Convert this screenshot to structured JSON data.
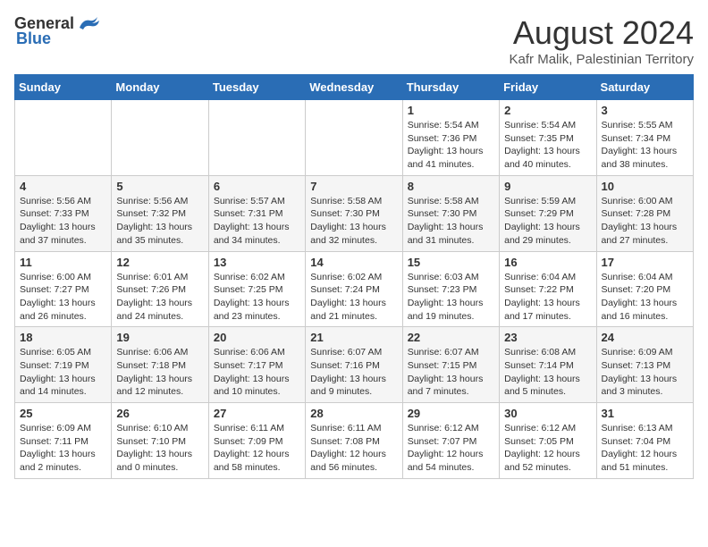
{
  "header": {
    "logo_general": "General",
    "logo_blue": "Blue",
    "title": "August 2024",
    "subtitle": "Kafr Malik, Palestinian Territory"
  },
  "calendar": {
    "days_of_week": [
      "Sunday",
      "Monday",
      "Tuesday",
      "Wednesday",
      "Thursday",
      "Friday",
      "Saturday"
    ],
    "weeks": [
      [
        {
          "day": "",
          "info": ""
        },
        {
          "day": "",
          "info": ""
        },
        {
          "day": "",
          "info": ""
        },
        {
          "day": "",
          "info": ""
        },
        {
          "day": "1",
          "info": "Sunrise: 5:54 AM\nSunset: 7:36 PM\nDaylight: 13 hours\nand 41 minutes."
        },
        {
          "day": "2",
          "info": "Sunrise: 5:54 AM\nSunset: 7:35 PM\nDaylight: 13 hours\nand 40 minutes."
        },
        {
          "day": "3",
          "info": "Sunrise: 5:55 AM\nSunset: 7:34 PM\nDaylight: 13 hours\nand 38 minutes."
        }
      ],
      [
        {
          "day": "4",
          "info": "Sunrise: 5:56 AM\nSunset: 7:33 PM\nDaylight: 13 hours\nand 37 minutes."
        },
        {
          "day": "5",
          "info": "Sunrise: 5:56 AM\nSunset: 7:32 PM\nDaylight: 13 hours\nand 35 minutes."
        },
        {
          "day": "6",
          "info": "Sunrise: 5:57 AM\nSunset: 7:31 PM\nDaylight: 13 hours\nand 34 minutes."
        },
        {
          "day": "7",
          "info": "Sunrise: 5:58 AM\nSunset: 7:30 PM\nDaylight: 13 hours\nand 32 minutes."
        },
        {
          "day": "8",
          "info": "Sunrise: 5:58 AM\nSunset: 7:30 PM\nDaylight: 13 hours\nand 31 minutes."
        },
        {
          "day": "9",
          "info": "Sunrise: 5:59 AM\nSunset: 7:29 PM\nDaylight: 13 hours\nand 29 minutes."
        },
        {
          "day": "10",
          "info": "Sunrise: 6:00 AM\nSunset: 7:28 PM\nDaylight: 13 hours\nand 27 minutes."
        }
      ],
      [
        {
          "day": "11",
          "info": "Sunrise: 6:00 AM\nSunset: 7:27 PM\nDaylight: 13 hours\nand 26 minutes."
        },
        {
          "day": "12",
          "info": "Sunrise: 6:01 AM\nSunset: 7:26 PM\nDaylight: 13 hours\nand 24 minutes."
        },
        {
          "day": "13",
          "info": "Sunrise: 6:02 AM\nSunset: 7:25 PM\nDaylight: 13 hours\nand 23 minutes."
        },
        {
          "day": "14",
          "info": "Sunrise: 6:02 AM\nSunset: 7:24 PM\nDaylight: 13 hours\nand 21 minutes."
        },
        {
          "day": "15",
          "info": "Sunrise: 6:03 AM\nSunset: 7:23 PM\nDaylight: 13 hours\nand 19 minutes."
        },
        {
          "day": "16",
          "info": "Sunrise: 6:04 AM\nSunset: 7:22 PM\nDaylight: 13 hours\nand 17 minutes."
        },
        {
          "day": "17",
          "info": "Sunrise: 6:04 AM\nSunset: 7:20 PM\nDaylight: 13 hours\nand 16 minutes."
        }
      ],
      [
        {
          "day": "18",
          "info": "Sunrise: 6:05 AM\nSunset: 7:19 PM\nDaylight: 13 hours\nand 14 minutes."
        },
        {
          "day": "19",
          "info": "Sunrise: 6:06 AM\nSunset: 7:18 PM\nDaylight: 13 hours\nand 12 minutes."
        },
        {
          "day": "20",
          "info": "Sunrise: 6:06 AM\nSunset: 7:17 PM\nDaylight: 13 hours\nand 10 minutes."
        },
        {
          "day": "21",
          "info": "Sunrise: 6:07 AM\nSunset: 7:16 PM\nDaylight: 13 hours\nand 9 minutes."
        },
        {
          "day": "22",
          "info": "Sunrise: 6:07 AM\nSunset: 7:15 PM\nDaylight: 13 hours\nand 7 minutes."
        },
        {
          "day": "23",
          "info": "Sunrise: 6:08 AM\nSunset: 7:14 PM\nDaylight: 13 hours\nand 5 minutes."
        },
        {
          "day": "24",
          "info": "Sunrise: 6:09 AM\nSunset: 7:13 PM\nDaylight: 13 hours\nand 3 minutes."
        }
      ],
      [
        {
          "day": "25",
          "info": "Sunrise: 6:09 AM\nSunset: 7:11 PM\nDaylight: 13 hours\nand 2 minutes."
        },
        {
          "day": "26",
          "info": "Sunrise: 6:10 AM\nSunset: 7:10 PM\nDaylight: 13 hours\nand 0 minutes."
        },
        {
          "day": "27",
          "info": "Sunrise: 6:11 AM\nSunset: 7:09 PM\nDaylight: 12 hours\nand 58 minutes."
        },
        {
          "day": "28",
          "info": "Sunrise: 6:11 AM\nSunset: 7:08 PM\nDaylight: 12 hours\nand 56 minutes."
        },
        {
          "day": "29",
          "info": "Sunrise: 6:12 AM\nSunset: 7:07 PM\nDaylight: 12 hours\nand 54 minutes."
        },
        {
          "day": "30",
          "info": "Sunrise: 6:12 AM\nSunset: 7:05 PM\nDaylight: 12 hours\nand 52 minutes."
        },
        {
          "day": "31",
          "info": "Sunrise: 6:13 AM\nSunset: 7:04 PM\nDaylight: 12 hours\nand 51 minutes."
        }
      ]
    ]
  }
}
